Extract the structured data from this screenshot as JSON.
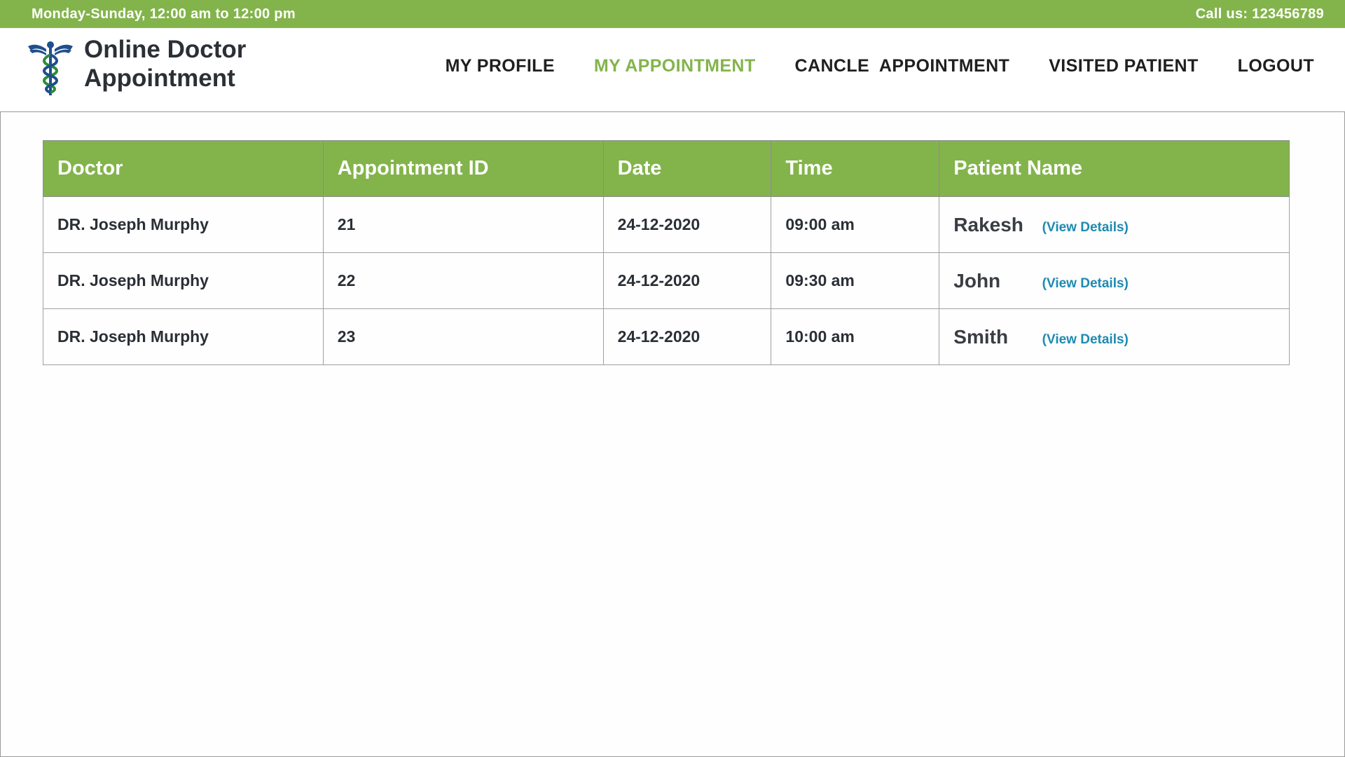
{
  "topbar": {
    "hours": "Monday-Sunday, 12:00 am to 12:00 pm",
    "phone": "Call us: 123456789"
  },
  "brand": {
    "line1": "Online Doctor",
    "line2": "Appointment",
    "logo_icon": "caduceus-icon"
  },
  "nav": {
    "items": [
      {
        "label": "MY PROFILE"
      },
      {
        "label": "MY APPOINTMENT"
      },
      {
        "label": "CANCLE  APPOINTMENT"
      },
      {
        "label": "VISITED PATIENT"
      },
      {
        "label": "LOGOUT"
      }
    ],
    "active": "MY APPOINTMENT"
  },
  "table": {
    "headers": [
      "Doctor",
      "Appointment ID",
      "Date",
      "Time",
      "Patient Name"
    ],
    "rows": [
      {
        "doctor": "DR. Joseph Murphy",
        "id": "21",
        "date": "24-12-2020",
        "time": "09:00 am",
        "patient": "Rakesh",
        "link": "(View Details)"
      },
      {
        "doctor": "DR. Joseph Murphy",
        "id": "22",
        "date": "24-12-2020",
        "time": "09:30 am",
        "patient": "John",
        "link": "(View Details)"
      },
      {
        "doctor": "DR. Joseph Murphy",
        "id": "23",
        "date": "24-12-2020",
        "time": "10:00 am",
        "patient": "Smith",
        "link": "(View Details)"
      }
    ]
  },
  "colors": {
    "accent_green": "#83b44b",
    "link_blue": "#1e8ab0",
    "text_dark": "#2b2f36"
  }
}
